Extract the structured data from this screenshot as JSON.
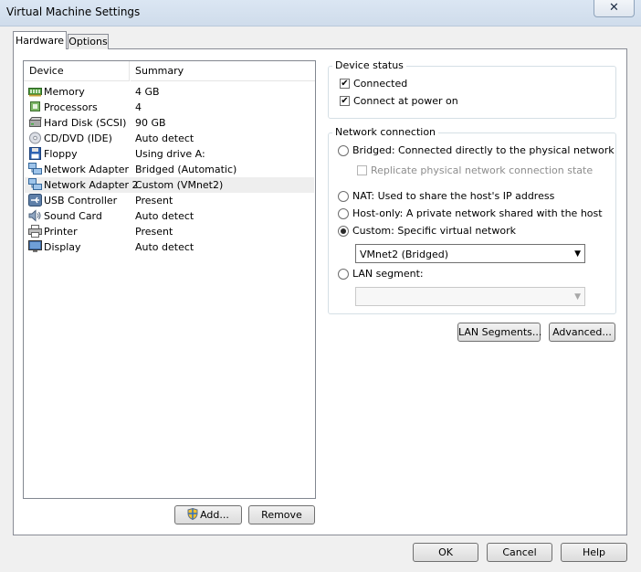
{
  "window": {
    "title": "Virtual Machine Settings",
    "close_glyph": "✕"
  },
  "tabs": [
    {
      "label": "Hardware",
      "active": true
    },
    {
      "label": "Options",
      "active": false
    }
  ],
  "device_list": {
    "columns": [
      "Device",
      "Summary"
    ],
    "rows": [
      {
        "device": "Memory",
        "summary": "4 GB",
        "icon": "memory-icon"
      },
      {
        "device": "Processors",
        "summary": "4",
        "icon": "processor-icon"
      },
      {
        "device": "Hard Disk (SCSI)",
        "summary": "90 GB",
        "icon": "hard-disk-icon"
      },
      {
        "device": "CD/DVD (IDE)",
        "summary": "Auto detect",
        "icon": "cd-dvd-icon"
      },
      {
        "device": "Floppy",
        "summary": "Using drive A:",
        "icon": "floppy-icon"
      },
      {
        "device": "Network Adapter",
        "summary": "Bridged (Automatic)",
        "icon": "network-adapter-icon"
      },
      {
        "device": "Network Adapter 2",
        "summary": "Custom (VMnet2)",
        "icon": "network-adapter-icon",
        "selected": true
      },
      {
        "device": "USB Controller",
        "summary": "Present",
        "icon": "usb-icon"
      },
      {
        "device": "Sound Card",
        "summary": "Auto detect",
        "icon": "sound-card-icon"
      },
      {
        "device": "Printer",
        "summary": "Present",
        "icon": "printer-icon"
      },
      {
        "device": "Display",
        "summary": "Auto detect",
        "icon": "display-icon"
      }
    ]
  },
  "list_buttons": {
    "add": "Add...",
    "remove": "Remove"
  },
  "device_status": {
    "title": "Device status",
    "connected": {
      "label": "Connected",
      "checked": true
    },
    "connect_at_power_on": {
      "label": "Connect at power on",
      "checked": true
    }
  },
  "network_connection": {
    "title": "Network connection",
    "bridged": {
      "label": "Bridged: Connected directly to the physical network",
      "selected": false
    },
    "replicate": {
      "label": "Replicate physical network connection state",
      "checked": false,
      "disabled": true
    },
    "nat": {
      "label": "NAT: Used to share the host's IP address",
      "selected": false
    },
    "host_only": {
      "label": "Host-only: A private network shared with the host",
      "selected": false
    },
    "custom": {
      "label": "Custom: Specific virtual network",
      "selected": true
    },
    "custom_network": {
      "value": "VMnet2 (Bridged)"
    },
    "lan_segment": {
      "label": "LAN segment:",
      "selected": false
    },
    "lan_segment_select": {
      "value": "",
      "disabled": true
    }
  },
  "panel_buttons": {
    "lan_segments": "LAN Segments...",
    "advanced": "Advanced..."
  },
  "dialog_buttons": {
    "ok": "OK",
    "cancel": "Cancel",
    "help": "Help"
  },
  "colors": {
    "titlebar": "#dbe6f3",
    "selection": "#eeeeee",
    "border": "#828790"
  }
}
